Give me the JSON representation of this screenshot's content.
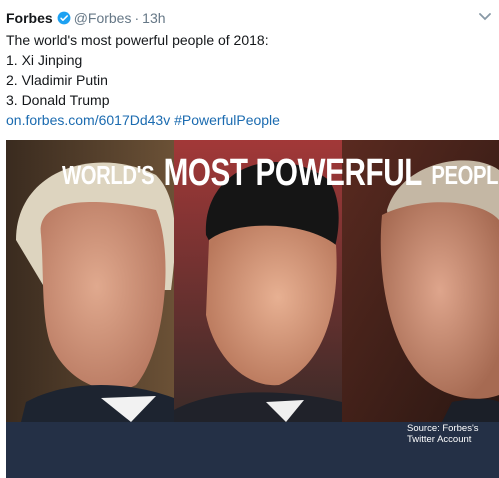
{
  "tweet": {
    "author_name": "Forbes",
    "handle": "@Forbes",
    "separator": "·",
    "time": "13h",
    "lines": [
      "The world's most powerful people of 2018:",
      "1. Xi Jinping",
      "2. Vladimir Putin",
      "3. Donald Trump"
    ],
    "link_url": "on.forbes.com/6017Dd43v",
    "hashtag": "#PowerfulPeople"
  },
  "image": {
    "banner_part1": "WORLD'S",
    "banner_part2": "MOST POWERFUL",
    "banner_part3": "PEOPLE",
    "source_line1": "Source: Forbes's",
    "source_line2": "Twitter Account"
  },
  "icons": {
    "verified": "verified-badge-icon",
    "menu": "chevron-down-icon"
  },
  "colors": {
    "link": "#1b6bb0",
    "banner": "#243046",
    "verified": "#1da1f2"
  }
}
